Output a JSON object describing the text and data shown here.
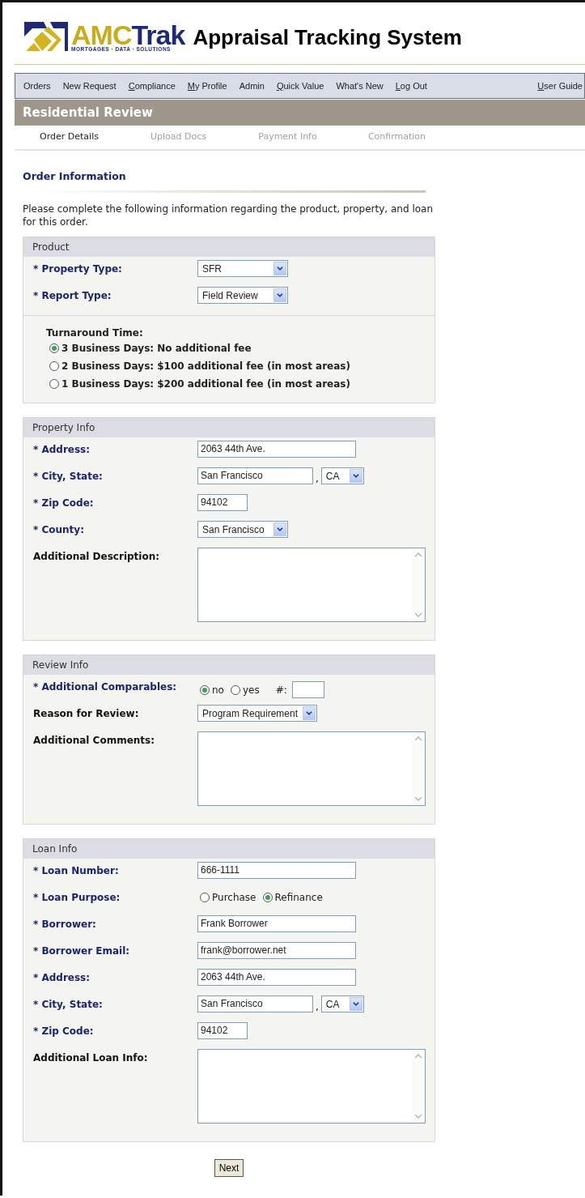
{
  "header": {
    "logo": {
      "part_1": "AMC",
      "part_2": "Trak",
      "tagline": "MORTGAGES · DATA · SOLUTIONS"
    },
    "title": "Appraisal Tracking System"
  },
  "nav": {
    "items": [
      {
        "label": "Orders",
        "access_key": false
      },
      {
        "label": "New Request",
        "access_key": false
      },
      {
        "label": "Compliance",
        "access_key": true
      },
      {
        "label": "My Profile",
        "access_key": true
      },
      {
        "label": "Admin",
        "access_key": false
      },
      {
        "label": "Quick Value",
        "access_key": true
      },
      {
        "label": "What's New",
        "access_key": false
      },
      {
        "label": "Log Out",
        "access_key": true
      }
    ],
    "right": {
      "label": "User Guide",
      "access_key": true
    }
  },
  "page_title": "Residential Review",
  "steps": [
    {
      "label": "Order Details",
      "selected": true
    },
    {
      "label": "Upload Docs",
      "selected": false
    },
    {
      "label": "Payment Info",
      "selected": false
    },
    {
      "label": "Confirmation",
      "selected": false
    }
  ],
  "heading": "Order Information",
  "intro": "Please complete the following information regarding the product, property, and loan for this order.",
  "sections": [
    {
      "title": "Product",
      "rows": [
        {
          "label": "* Property Type:",
          "required": true,
          "kind": "select",
          "value": "SFR"
        },
        {
          "label": "* Report Type:",
          "required": true,
          "kind": "select",
          "value": "Field Review"
        }
      ],
      "subpanel": {
        "title": "Turnaround Time:",
        "options": [
          {
            "label": "3 Business Days: No additional fee",
            "selected": true
          },
          {
            "label": "2 Business Days: $100 additional fee (in most areas)",
            "selected": false
          },
          {
            "label": "1 Business Days: $200 additional fee (in most areas)",
            "selected": false
          }
        ]
      }
    },
    {
      "title": "Property Info",
      "rows": [
        {
          "label": "* Address:",
          "required": true,
          "kind": "text",
          "value": "2063 44th Ave."
        },
        {
          "label": "* City, State:",
          "required": true,
          "kind": "city_state",
          "value": "San Francisco",
          "separator": ",",
          "state": "CA"
        },
        {
          "label": "* Zip Code:",
          "required": true,
          "kind": "zip",
          "value": "94102"
        },
        {
          "label": "* County:",
          "required": true,
          "kind": "select",
          "value": "San Francisco"
        },
        {
          "label": "Additional Description:",
          "required": false,
          "kind": "textarea"
        }
      ]
    },
    {
      "title": "Review Info",
      "rows": [
        {
          "label": "* Additional Comparables:",
          "required": true,
          "kind": "radios",
          "options": [
            {
              "label": "no",
              "selected": true
            },
            {
              "label": "yes",
              "selected": false
            }
          ],
          "count_label": "#:"
        },
        {
          "label": "Reason for Review:",
          "required": false,
          "kind": "select",
          "value": "Program Requirement"
        },
        {
          "label": "Additional Comments:",
          "required": false,
          "kind": "textarea"
        }
      ]
    },
    {
      "title": "Loan Info",
      "rows": [
        {
          "label": "* Loan Number:",
          "required": true,
          "kind": "text",
          "value": "666-1111"
        },
        {
          "label": "* Loan Purpose:",
          "required": true,
          "kind": "radios",
          "options": [
            {
              "label": "Purchase",
              "selected": false
            },
            {
              "label": "Refinance",
              "selected": true
            }
          ]
        },
        {
          "label": "* Borrower:",
          "required": true,
          "kind": "text",
          "value": "Frank Borrower"
        },
        {
          "label": "* Borrower Email:",
          "required": true,
          "kind": "text",
          "value": "frank@borrower.net"
        },
        {
          "label": "* Address:",
          "required": true,
          "kind": "text",
          "value": "2063 44th Ave."
        },
        {
          "label": "* City, State:",
          "required": true,
          "kind": "city_state",
          "value": "San Francisco",
          "separator": ",",
          "state": "CA"
        },
        {
          "label": "* Zip Code:",
          "required": true,
          "kind": "zip",
          "value": "94102"
        },
        {
          "label": "Additional Loan Info:",
          "required": false,
          "kind": "textarea"
        }
      ]
    }
  ],
  "button": "Next"
}
